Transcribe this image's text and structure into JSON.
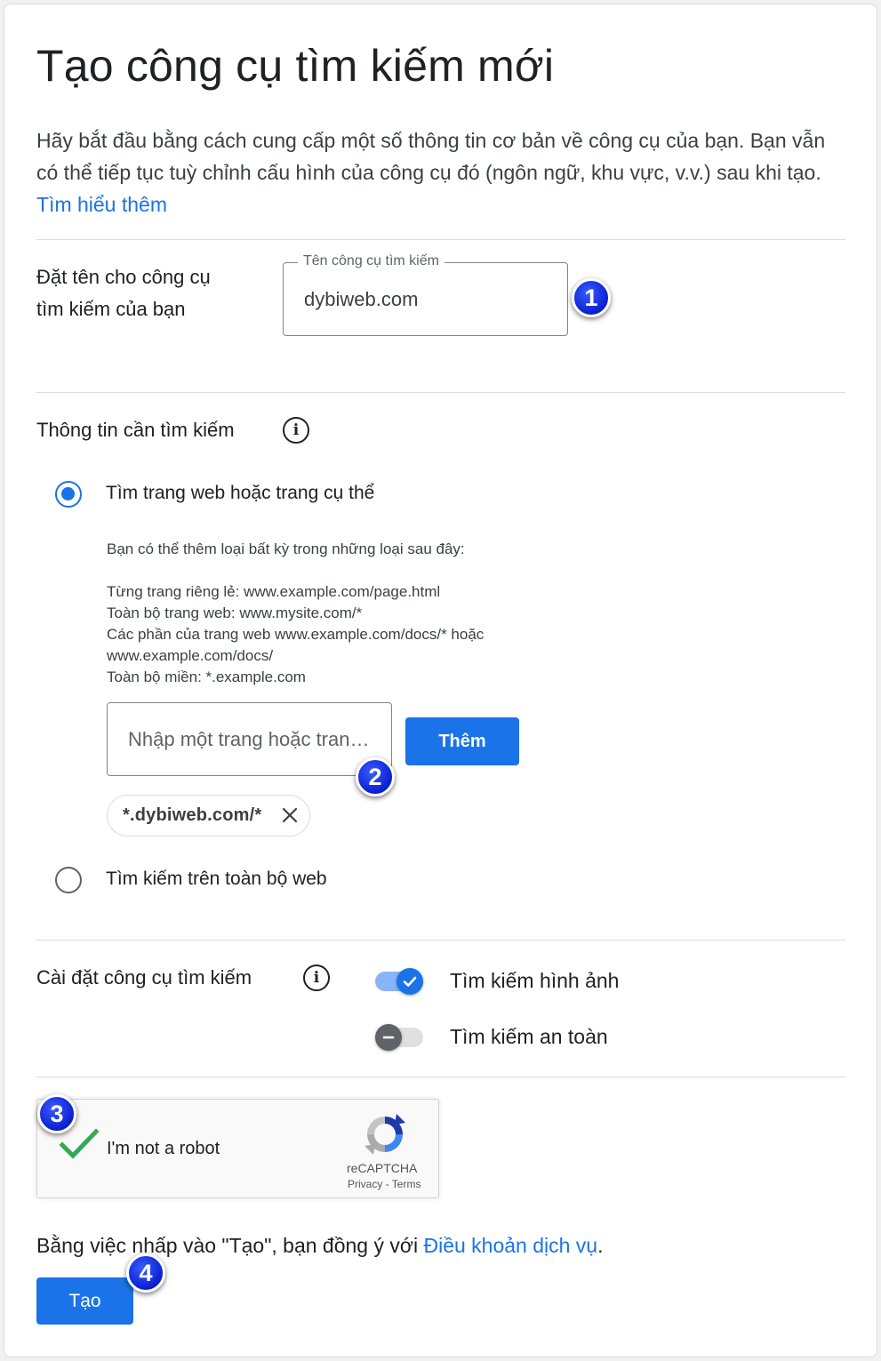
{
  "header": {
    "title": "Tạo công cụ tìm kiếm mới",
    "intro": "Hãy bắt đầu bằng cách cung cấp một số thông tin cơ bản về công cụ của bạn. Bạn vẫn có thể tiếp tục tuỳ chỉnh cấu hình của công cụ đó (ngôn ngữ, khu vực, v.v.) sau khi tạo.",
    "learn_more": "Tìm hiểu thêm"
  },
  "name_section": {
    "label": "Đặt tên cho công cụ tìm kiếm của bạn",
    "field_label": "Tên công cụ tìm kiếm",
    "field_value": "dybiweb.com"
  },
  "search_scope": {
    "label": "Thông tin cần tìm kiếm",
    "option_specific": "Tìm trang web hoặc trang cụ thể",
    "help_intro": "Bạn có thể thêm loại bất kỳ trong những loại sau đây:",
    "help_lines": [
      "Từng trang riêng lẻ: www.example.com/page.html",
      "Toàn bộ trang web: www.mysite.com/*",
      "Các phần của trang web www.example.com/docs/* hoặc",
      "www.example.com/docs/",
      "Toàn bộ miền: *.example.com"
    ],
    "site_input_placeholder": "Nhập một trang hoặc trang web",
    "add_button": "Thêm",
    "chip": "*.dybiweb.com/*",
    "option_entire_web": "Tìm kiếm trên toàn bộ web"
  },
  "settings": {
    "label": "Cài đặt công cụ tìm kiếm",
    "image_search": {
      "label": "Tìm kiếm hình ảnh",
      "enabled": true
    },
    "safe_search": {
      "label": "Tìm kiếm an toàn",
      "enabled": false
    }
  },
  "recaptcha": {
    "label": "I'm not a robot",
    "brand": "reCAPTCHA",
    "privacy": "Privacy",
    "separator": " - ",
    "terms": "Terms"
  },
  "footer": {
    "terms_prefix": "Bằng việc nhấp vào \"Tạo\", bạn đồng ý với ",
    "terms_link": "Điều khoản dịch vụ",
    "terms_suffix": ".",
    "create_button": "Tạo"
  },
  "badges": [
    "1",
    "2",
    "3",
    "4"
  ],
  "colors": {
    "accent": "#1a73e8",
    "badge": "#0a1fd0",
    "check_green": "#34a853"
  }
}
